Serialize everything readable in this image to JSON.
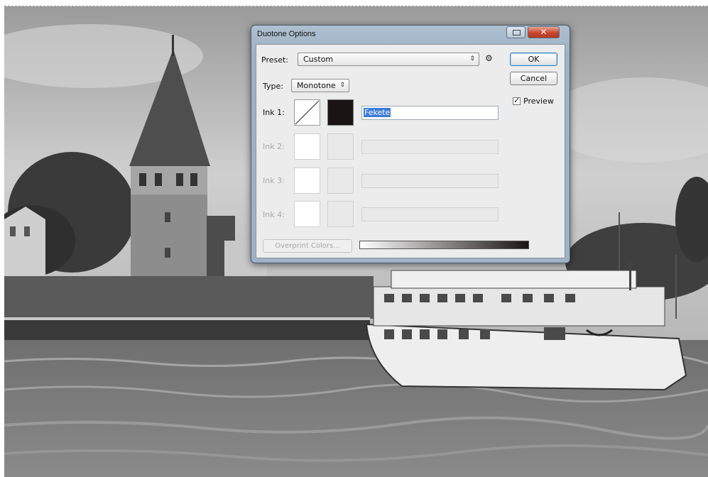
{
  "dialog": {
    "title": "Duotone Options",
    "preset_label": "Preset:",
    "preset_value": "Custom",
    "type_label": "Type:",
    "type_value": "Monotone",
    "ok_label": "OK",
    "cancel_label": "Cancel",
    "preview_label": "Preview",
    "preview_checked": true,
    "overprint_label": "Overprint Colors...",
    "inks": [
      {
        "label": "Ink 1:",
        "name": "Fekete",
        "enabled": true,
        "color": "#1a1414"
      },
      {
        "label": "Ink 2:",
        "name": "",
        "enabled": false
      },
      {
        "label": "Ink 3:",
        "name": "",
        "enabled": false
      },
      {
        "label": "Ink 4:",
        "name": "",
        "enabled": false
      }
    ]
  },
  "icons": {
    "gear": "gear-icon",
    "close": "close-icon",
    "restore": "restore-icon",
    "dropdown": "chevron-updown-icon",
    "check": "checkmark-icon"
  },
  "colors": {
    "title_bar": "#aebfd0",
    "close_button": "#c8452f",
    "selection": "#3b7bd6",
    "ink1": "#1a1414"
  }
}
